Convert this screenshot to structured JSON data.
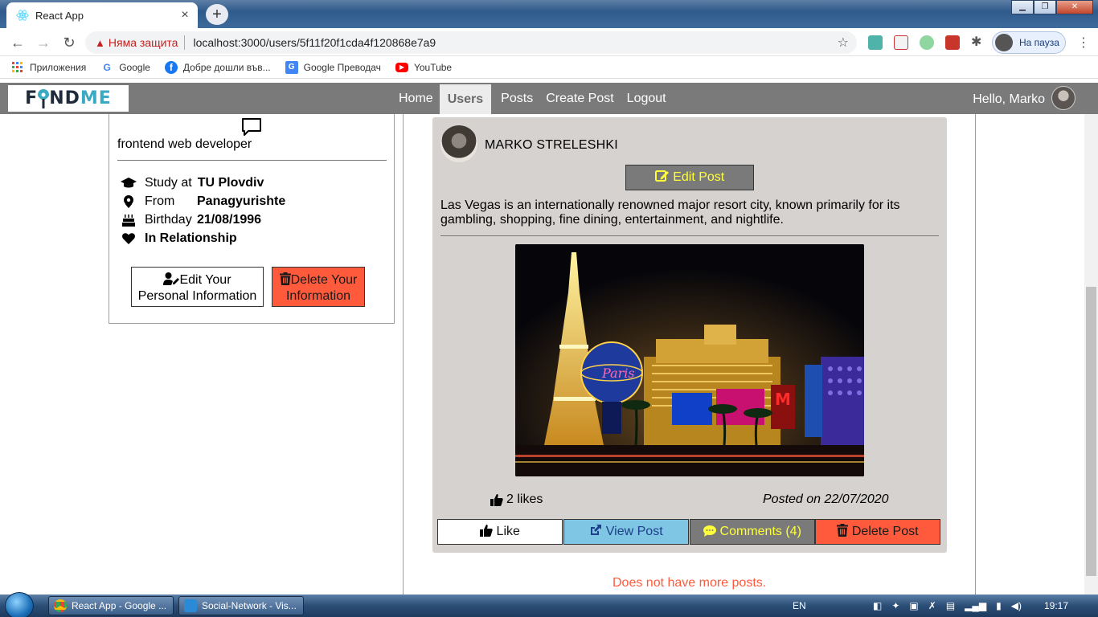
{
  "browser": {
    "tab_title": "React App",
    "tab_close": "×",
    "new_tab": "+",
    "security_text": "Няма защита",
    "url": "localhost:3000/users/5f11f20f1cda4f120868e7a9",
    "profile_label": "На пауза",
    "bookmarks": [
      {
        "label": "Приложения",
        "icon": "apps-grid-icon"
      },
      {
        "label": "Google",
        "icon": "google-icon"
      },
      {
        "label": "Добре дошли във...",
        "icon": "facebook-icon"
      },
      {
        "label": "Google Преводач",
        "icon": "translate-icon"
      },
      {
        "label": "YouTube",
        "icon": "youtube-icon"
      }
    ]
  },
  "navbar": {
    "logo_left": "F",
    "logo_i": "I",
    "logo_nd": "ND",
    "logo_me": "ME",
    "links": [
      "Home",
      "Users",
      "Posts",
      "Create Post",
      "Logout"
    ],
    "active": "Users",
    "greeting": "Hello, Marko"
  },
  "profile": {
    "bio": "frontend web developer",
    "study_label": "Study at",
    "study_value": "TU Plovdiv",
    "from_label": "From",
    "from_value": "Panagyurishte",
    "birthday_label": "Birthday",
    "birthday_value": "21/08/1996",
    "relationship": "In Relationship",
    "edit_button_line1": "Edit Your",
    "edit_button_line2": "Personal Information",
    "delete_button_line1": "Delete Your",
    "delete_button_line2": "Information"
  },
  "post": {
    "author": "MARKO STRELESHKI",
    "edit_label": "Edit Post",
    "text": "Las Vegas is an internationally renowned major resort city, known primarily for its gambling, shopping, fine dining, entertainment, and nightlife.",
    "likes": "2 likes",
    "posted_on": "Posted on 22/07/2020",
    "like_label": "Like",
    "view_label": "View Post",
    "comments_label": "Comments (4)",
    "delete_label": "Delete Post"
  },
  "feed_end": "Does not have more posts.",
  "taskbar": {
    "tasks": [
      "React App - Google ...",
      "Social-Network - Vis..."
    ],
    "lang": "EN",
    "time": "19:17"
  },
  "colors": {
    "navbar_bg": "#7a7a7a",
    "post_bg": "#d6d2d0",
    "danger": "#ff5a3c",
    "info": "#7fc6e4",
    "accent_yellow": "#ffff3a",
    "logo_teal": "#3aa9c2"
  }
}
